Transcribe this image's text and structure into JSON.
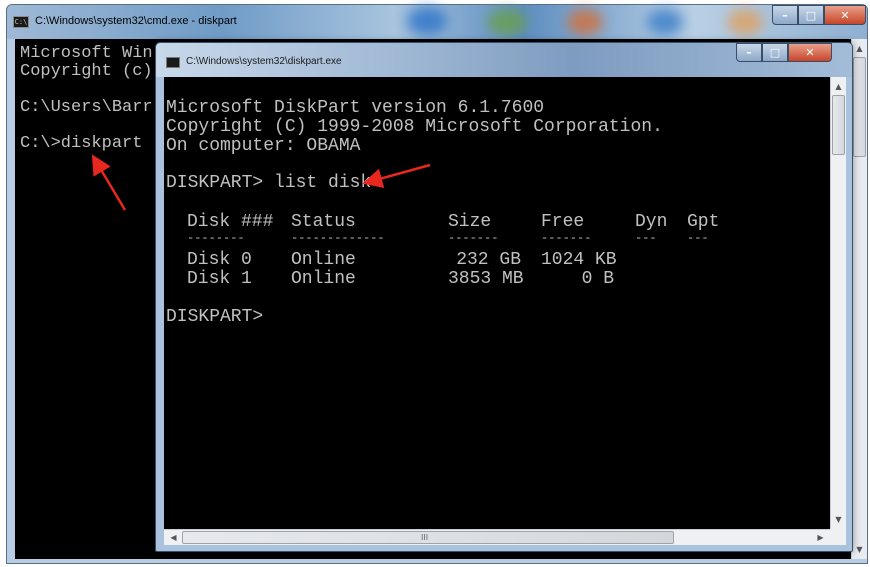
{
  "outer_window": {
    "title": "C:\\Windows\\system32\\cmd.exe - diskpart",
    "console_lines": [
      "Microsoft Win",
      "Copyright (c)",
      "",
      "C:\\Users\\Barr",
      "",
      "C:\\>diskpart"
    ]
  },
  "inner_window": {
    "title": "C:\\Windows\\system32\\diskpart.exe",
    "header_lines": [
      "Microsoft DiskPart version 6.1.7600",
      "Copyright (C) 1999-2008 Microsoft Corporation.",
      "On computer: OBAMA"
    ],
    "command_prompt": "DISKPART> list disk",
    "table": {
      "headers": [
        "Disk ###",
        "Status",
        "Size",
        "Free",
        "Dyn",
        "Gpt"
      ],
      "separators": [
        "--------",
        "-------------",
        "-------",
        "-------",
        "---",
        "---"
      ],
      "rows": [
        [
          "Disk 0",
          "Online",
          "232 GB",
          "1024 KB",
          "",
          ""
        ],
        [
          "Disk 1",
          "Online",
          "3853 MB",
          "0 B",
          "",
          ""
        ]
      ]
    },
    "final_prompt": "DISKPART>",
    "hscroll_grip": "III"
  },
  "window_controls": {
    "minimize": "–",
    "maximize": "□",
    "close": "✕"
  },
  "icons": {
    "cmd": "cmd-icon",
    "minimize": "minimize-icon",
    "maximize": "maximize-icon",
    "close": "close-icon",
    "annotation_arrow": "arrow-icon"
  },
  "colors": {
    "console_bg": "#000000",
    "console_fg": "#c0c0c0",
    "annotation": "#e8281e",
    "close_button": "#c8452a"
  }
}
